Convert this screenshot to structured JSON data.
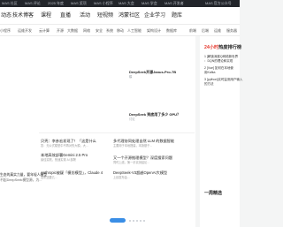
{
  "topbar": {
    "items": [
      "MAS 社区",
      "MAS 评论",
      "2025 年度",
      "MAS 奖项",
      "MAS 小程序",
      "MAS 大会",
      "MAS 学会",
      "MAS 开发者"
    ],
    "right": "MAS 官方公众号"
  },
  "nav": {
    "items": [
      "动态",
      "技术博客",
      "课程",
      "直播",
      "活动",
      "短视频",
      "鸿蒙社区",
      "企业学习",
      "题库"
    ]
  },
  "subnav": {
    "items": [
      "小程序",
      "运维开发",
      "云计算",
      "开源",
      "大数据",
      "网络",
      "安全",
      "系统",
      "移动",
      "人工智能",
      "架构设计",
      "数据库",
      "移动开发",
      "前端",
      "后端",
      "运维",
      "服务器"
    ]
  },
  "main": {
    "feature_1": {
      "title": "DeepSeek开源Janus-Pro-7B",
      "sub": "模"
    },
    "feature_2": {
      "title": "DeepSeek 到底用了多少 GPU？",
      "sub": "讨论"
    },
    "left_articles": [
      {
        "title": "贝壳：李彦宏发现了！「这是什么",
        "line2": "答：无公式模型中不再对的大模，大..."
      },
      {
        "title": "Anthropic被疑「模仿模型」，Claude 4",
        "line2": "发布还要几..."
      },
      {
        "title": "本地高效部署Gemini 2.5 Pro",
        "line2": "最佳实践，快速实现 AI 部署"
      }
    ],
    "right_articles": [
      {
        "title": "多代理协同处理自然 LLM 的数据智能",
        "line2": "主要用于本地搭建，本篇基于..."
      },
      {
        "title": "又一个开源推理模型？深度搜索问题",
        "line2": "同时上线，第一手实测结论..."
      },
      {
        "title": "DeepSeek-V3超越OpenAI大模型",
        "line2": "上线发布会..."
      }
    ],
    "edge_text": [
      "生态的真实力量，要年轻人模型",
      "不起DeepSeek模型源，为..."
    ]
  },
  "sidebar": {
    "header_label": "频道",
    "hot_title_red": "24小时",
    "hot_title_rest": "热度排行榜",
    "hot_items": [
      "1 [解锁深度Q网络新世界",
      "  ：DQN的理论和实现",
      "2 [Vue] 如何在本地使",
      "  用Kafka",
      "3 [python]实时监测用户输入",
      "  的方法"
    ],
    "section": "一周精选"
  },
  "carousel": {
    "dots": 6
  }
}
